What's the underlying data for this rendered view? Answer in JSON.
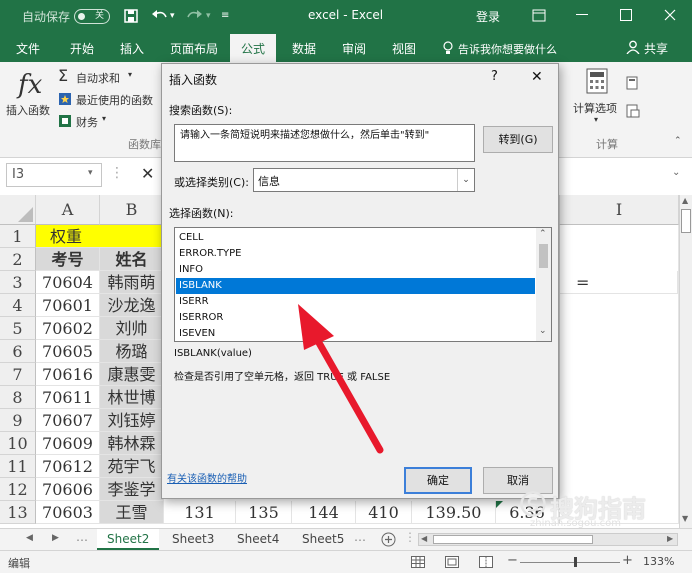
{
  "titlebar": {
    "autosave_label": "自动保存",
    "autosave_state": "关",
    "document_title": "excel  -  Excel",
    "login": "登录"
  },
  "ribbon_tabs": [
    "文件",
    "开始",
    "插入",
    "页面布局",
    "公式",
    "数据",
    "审阅",
    "视图"
  ],
  "active_tab": "公式",
  "tell_me": "告诉我你想要做什么",
  "share": "共享",
  "ribbon": {
    "insert_function": "插入函数",
    "autosum": "自动求和",
    "recent": "最近使用的函数",
    "financial": "财务",
    "group_library": "函数库",
    "calc_options": "计算选项",
    "group_calc": "计算"
  },
  "formula_bar": {
    "name_box": "I3",
    "cancel_symbol": "✕"
  },
  "grid": {
    "columns": [
      "A",
      "B",
      "I"
    ],
    "rows": [
      "1",
      "2",
      "3",
      "4",
      "5",
      "6",
      "7",
      "8",
      "9",
      "10",
      "11",
      "12",
      "13"
    ],
    "row1_a": "权重",
    "row2": [
      "考号",
      "姓名"
    ],
    "records": [
      [
        "70604",
        "韩雨萌"
      ],
      [
        "70601",
        "沙龙逸"
      ],
      [
        "70602",
        "刘帅"
      ],
      [
        "70605",
        "杨璐"
      ],
      [
        "70616",
        "康惠雯"
      ],
      [
        "70611",
        "林世博"
      ],
      [
        "70607",
        "刘钰婷"
      ],
      [
        "70609",
        "韩林霖"
      ],
      [
        "70612",
        "苑宇飞"
      ],
      [
        "70606",
        "李鉴学"
      ]
    ],
    "row13": [
      "70603",
      "王雪",
      "131",
      "135",
      "144",
      "410",
      "139.50",
      "6.36"
    ],
    "i3_value": "="
  },
  "sheets": [
    "Sheet2",
    "Sheet3",
    "Sheet4",
    "Sheet5"
  ],
  "active_sheet": "Sheet2",
  "status": {
    "mode": "编辑",
    "zoom": "133%"
  },
  "dialog": {
    "title": "插入函数",
    "help_symbol": "?",
    "close_symbol": "✕",
    "search_label": "搜索函数(S):",
    "search_value": "请输入一条简短说明来描述您想做什么，然后单击\"转到\"",
    "go_button": "转到(G)",
    "category_label": "或选择类别(C):",
    "category_value": "信息",
    "select_label": "选择函数(N):",
    "functions": [
      "CELL",
      "ERROR.TYPE",
      "INFO",
      "ISBLANK",
      "ISERR",
      "ISERROR",
      "ISEVEN"
    ],
    "selected_function": "ISBLANK",
    "signature": "ISBLANK(value)",
    "description": "检查是否引用了空单元格，返回 TRUE 或 FALSE",
    "help_link": "有关该函数的帮助",
    "ok": "确定",
    "cancel": "取消"
  },
  "watermark": {
    "text": "搜狗指南",
    "url": "zhinan.sogou.com"
  },
  "colors": {
    "excel_green": "#217346",
    "selection_blue": "#0078d7",
    "arrow_red": "#e8192c"
  }
}
